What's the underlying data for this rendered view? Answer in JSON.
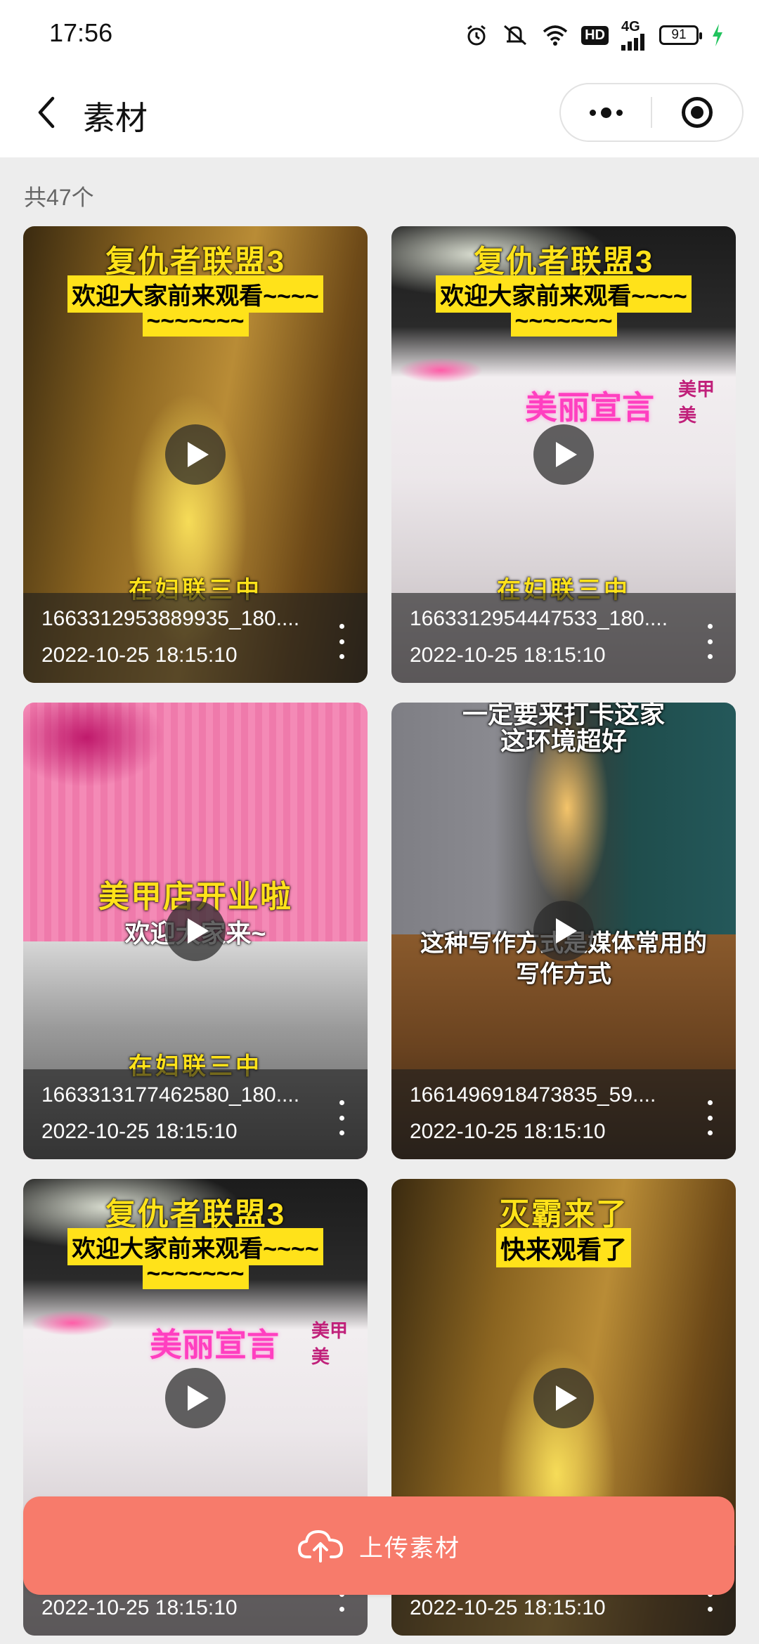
{
  "status_bar": {
    "time": "17:56",
    "network": "4G",
    "hd": "HD",
    "battery": "91",
    "icons": [
      "alarm-icon",
      "mute-icon",
      "wifi-icon",
      "hd-icon",
      "signal-icon",
      "battery-icon",
      "charging-icon"
    ]
  },
  "nav": {
    "title": "素材",
    "back_icon": "chevron-left-icon",
    "more_icon": "more-dots-icon",
    "close_icon": "target-icon"
  },
  "count_text": "共47个",
  "items": [
    {
      "file_name": "1663312953889935_180....",
      "date": "2022-10-25 18:15:10",
      "banner_title": "复仇者联盟3",
      "banner_sub": "欢迎大家前来观看~~~~",
      "banner_sub2": "~~~~~~~",
      "bottom_tag": "在妇联三中"
    },
    {
      "file_name": "1663312954447533_180....",
      "date": "2022-10-25 18:15:10",
      "banner_title": "复仇者联盟3",
      "banner_sub": "欢迎大家前来观看~~~~",
      "banner_sub2": "~~~~~~~",
      "sign_text": "美丽宣言",
      "sign_side": "美甲 美",
      "bottom_tag": "在妇联三中"
    },
    {
      "file_name": "1663313177462580_180....",
      "date": "2022-10-25 18:15:10",
      "banner_title": "美甲店开业啦",
      "banner_sub": "欢迎大家来~",
      "bottom_tag": "在妇联三中"
    },
    {
      "file_name": "1661496918473835_59....",
      "date": "2022-10-25 18:15:10",
      "top_caption": "一定要来打卡这家",
      "top_caption2": "这环境超好",
      "mid_caption": "这种写作方式是媒体常用的",
      "mid_caption2": "写作方式"
    },
    {
      "file_name": "",
      "date": "2022-10-25 18:15:10",
      "banner_title": "复仇者联盟3",
      "banner_sub": "欢迎大家前来观看~~~~",
      "banner_sub2": "~~~~~~~",
      "sign_text": "美丽宣言",
      "sign_side": "美甲 美"
    },
    {
      "file_name": "",
      "date": "2022-10-25 18:15:10",
      "banner_title": "灭霸来了",
      "banner_sub": "快来观看了"
    }
  ],
  "upload": {
    "label": "上传素材",
    "icon": "cloud-upload-icon",
    "color": "#f77b6b"
  }
}
